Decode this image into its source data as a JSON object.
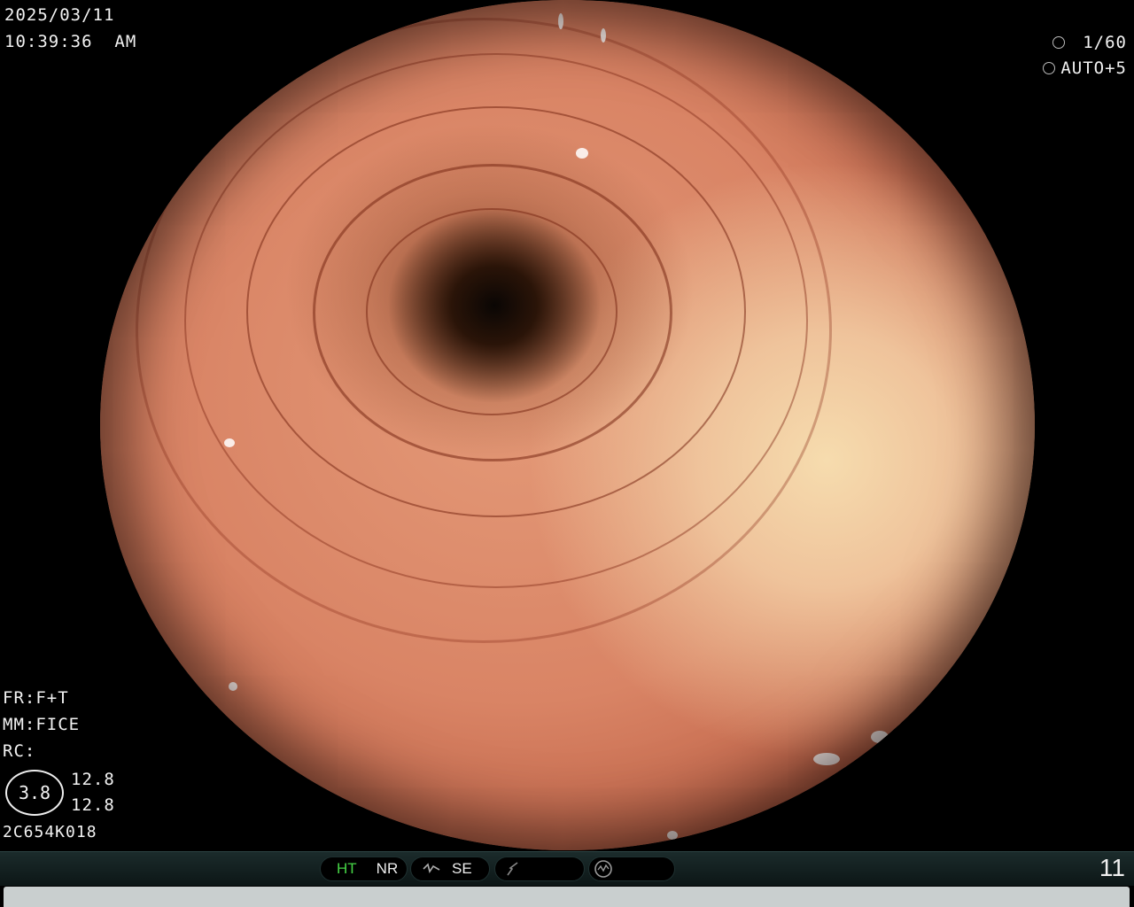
{
  "header": {
    "date": "2025/03/11",
    "time": "10:39:36  AM"
  },
  "settings": {
    "shutter": "1/60",
    "iris": "AUTO+5"
  },
  "left_info": {
    "fr": "FR:F+T",
    "mm": "MM:FICE",
    "rc": "RC:",
    "zoom": "3.8",
    "value_1": "12.8",
    "value_2": "12.8",
    "serial": "2C654K018"
  },
  "status_bar": {
    "ht_label": "HT",
    "nr_label": "NR",
    "se_label": "SE",
    "page_number": "11"
  },
  "icons": {
    "shutter": "shutter-icon",
    "iris": "iris-icon",
    "se": "structure-enhancement-icon",
    "color": "color-enhancement-icon",
    "mode": "mode-icon"
  }
}
